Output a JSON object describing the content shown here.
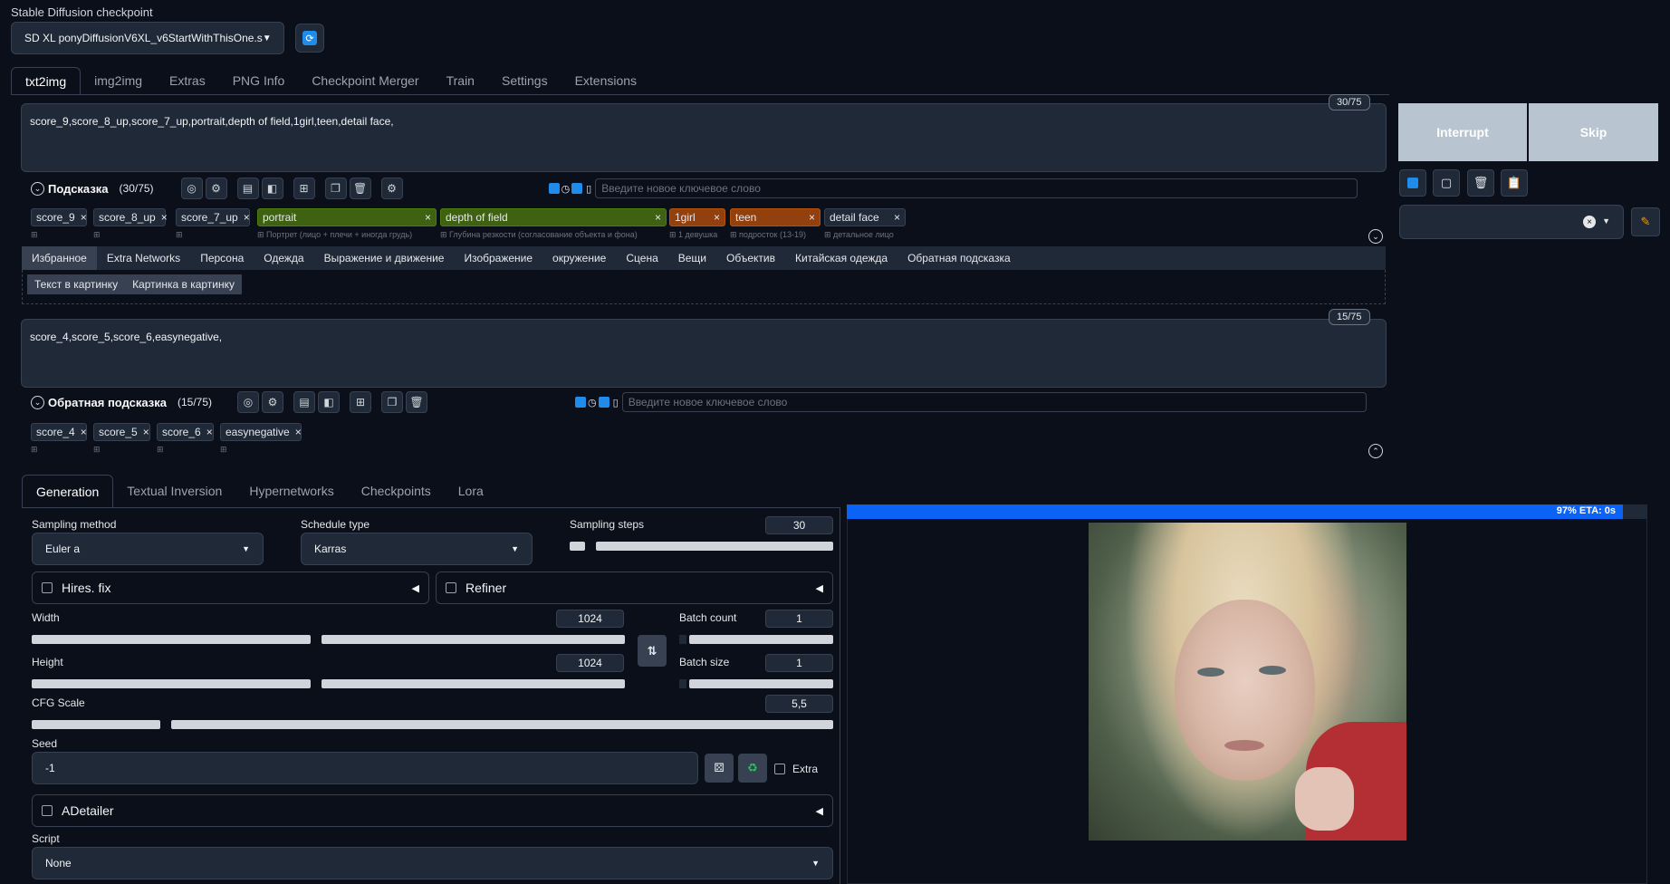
{
  "checkpoint": {
    "label": "Stable Diffusion checkpoint",
    "value": "SD XL ponyDiffusionV6XL_v6StartWithThisOne.s"
  },
  "tabs": [
    "txt2img",
    "img2img",
    "Extras",
    "PNG Info",
    "Checkpoint Merger",
    "Train",
    "Settings",
    "Extensions"
  ],
  "prompt": {
    "text": "score_9,score_8_up,score_7_up,portrait,depth of field,1girl,teen,detail face,",
    "counter": "30/75",
    "title": "Подсказка",
    "count": "(30/75)",
    "keyword_placeholder": "Введите новое ключевое слово",
    "tags": [
      {
        "text": "score_9",
        "sub": ""
      },
      {
        "text": "score_8_up",
        "sub": ""
      },
      {
        "text": "score_7_up",
        "sub": ""
      },
      {
        "text": "portrait",
        "sub": "Портрет (лицо + плечи + иногда грудь)"
      },
      {
        "text": "depth of field",
        "sub": "Глубина резкости (согласование объекта и фона)"
      },
      {
        "text": "1girl",
        "sub": "1 девушка"
      },
      {
        "text": "teen",
        "sub": "подросток (13-19)"
      },
      {
        "text": "detail face",
        "sub": "детальное лицо"
      }
    ]
  },
  "categories": [
    "Избранное",
    "Extra Networks",
    "Персона",
    "Одежда",
    "Выражение и движение",
    "Изображение",
    "окружение",
    "Сцена",
    "Вещи",
    "Объектив",
    "Китайская одежда",
    "Обратная подсказка"
  ],
  "sub_buttons": [
    "Текст в картинку",
    "Картинка в картинку"
  ],
  "negative": {
    "text": "score_4,score_5,score_6,easynegative,",
    "counter": "15/75",
    "title": "Обратная подсказка",
    "count": "(15/75)",
    "keyword_placeholder": "Введите новое ключевое слово",
    "tags": [
      "score_4",
      "score_5",
      "score_6",
      "easynegative"
    ]
  },
  "gen_tabs": [
    "Generation",
    "Textual Inversion",
    "Hypernetworks",
    "Checkpoints",
    "Lora"
  ],
  "sampling_method": {
    "label": "Sampling method",
    "value": "Euler a"
  },
  "schedule_type": {
    "label": "Schedule type",
    "value": "Karras"
  },
  "sampling_steps": {
    "label": "Sampling steps",
    "value": "30",
    "fraction": 0.06
  },
  "hires": "Hires. fix",
  "refiner": "Refiner",
  "width": {
    "label": "Width",
    "value": "1024",
    "fraction": 0.47
  },
  "height": {
    "label": "Height",
    "value": "1024",
    "fraction": 0.47
  },
  "batch_count": {
    "label": "Batch count",
    "value": "1"
  },
  "batch_size": {
    "label": "Batch size",
    "value": "1"
  },
  "cfg": {
    "label": "CFG Scale",
    "value": "5,5",
    "fraction": 0.16
  },
  "seed": {
    "label": "Seed",
    "value": "-1",
    "extra": "Extra"
  },
  "adetailer": "ADetailer",
  "script": {
    "label": "Script",
    "value": "None"
  },
  "right": {
    "interrupt": "Interrupt",
    "skip": "Skip"
  },
  "progress": {
    "text": "97% ETA: 0s",
    "fraction": 0.97
  },
  "colors": {
    "accent": "#1f8ceb",
    "progress": "#0b63f6",
    "green_tag": "#3f6212",
    "orange_tag": "#92400e"
  }
}
